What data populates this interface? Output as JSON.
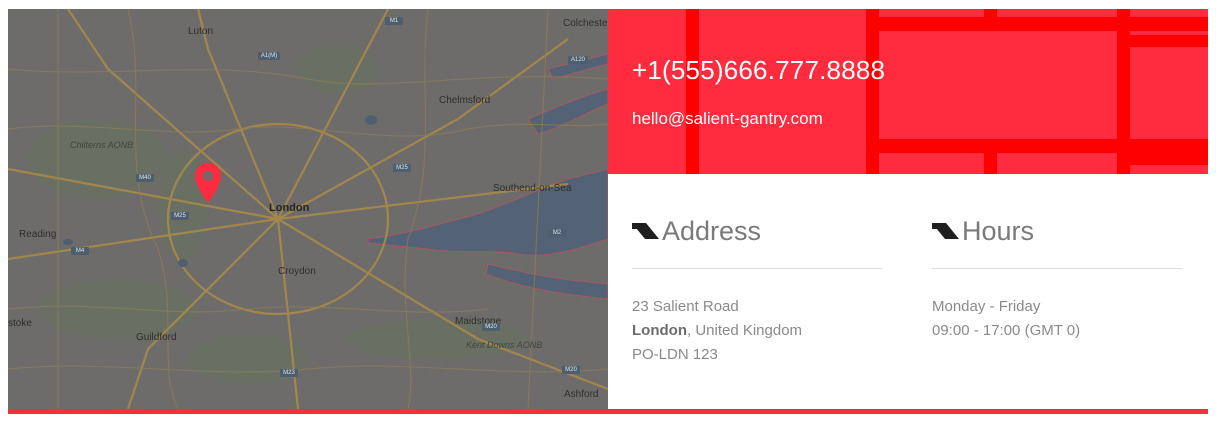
{
  "map": {
    "labels": {
      "luton": "Luton",
      "colchester": "Colchester",
      "chelmsford": "Chelmsford",
      "chilterns": "Chilterns AONB",
      "london": "London",
      "southend": "Southend-on-Sea",
      "reading": "Reading",
      "croydon": "Croydon",
      "stoke": "stoke",
      "guildford": "Guildford",
      "maidstone": "Maidstone",
      "kent_downs": "Kent Downs AONB",
      "ashford": "Ashford"
    },
    "roads": {
      "m1": "M1",
      "a1m": "A1(M)",
      "a120": "A120",
      "m25_n": "M25",
      "m40": "M40",
      "m25_w": "M25",
      "m4": "M4",
      "m2": "M2",
      "m20": "M20",
      "m23": "M23",
      "m20_s": "M20",
      "a12": "A12"
    },
    "pin_icon": "map-marker-icon",
    "pin_color": "#ff2b3e"
  },
  "contact": {
    "phone": "+1(555)666.777.8888",
    "email": "hello@salient-gantry.com",
    "bg_color": "#ff2b3e"
  },
  "address": {
    "icon": "parallelogram-icon",
    "title": "Address",
    "line1": "23 Salient Road",
    "city": "London",
    "country_suffix": ", United Kingdom",
    "postcode": "PO-LDN 123"
  },
  "hours": {
    "icon": "parallelogram-icon",
    "title": "Hours",
    "days": "Monday - Friday",
    "time": "09:00 - 17:00 (GMT 0)"
  }
}
